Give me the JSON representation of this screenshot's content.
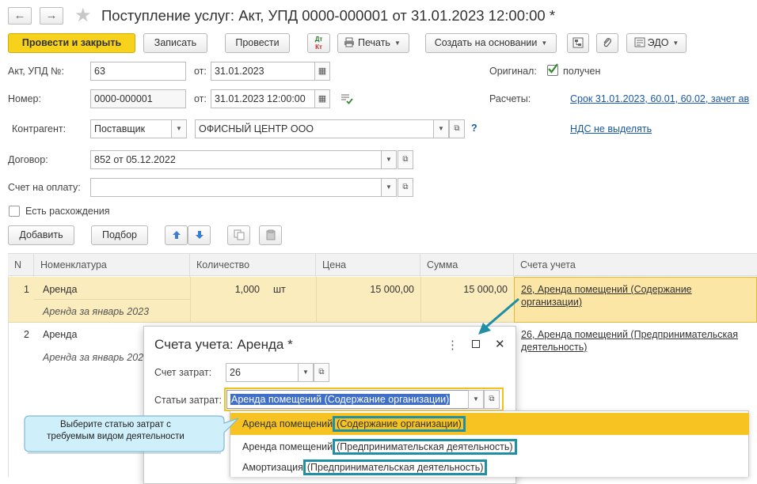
{
  "window": {
    "title": "Поступление услуг: Акт, УПД 0000-000001 от 31.01.2023 12:00:00 *",
    "back_glyph": "←",
    "forward_glyph": "→",
    "star_glyph": "★"
  },
  "toolbar": {
    "post_close": "Провести и закрыть",
    "save": "Записать",
    "post": "Провести",
    "dt_kt_top": "Дт",
    "dt_kt_bottom": "Кт",
    "print": "Печать",
    "create_based": "Создать на основании",
    "edo": "ЭДО"
  },
  "header": {
    "act_label": "Акт, УПД №:",
    "act_value": "63",
    "from_label": "от:",
    "act_date": "31.01.2023",
    "original_label": "Оригинал:",
    "original_checked": true,
    "original_value": "получен",
    "number_label": "Номер:",
    "number_value": "0000-000001",
    "from_label2": "от:",
    "number_date": "31.01.2023 12:00:00",
    "settlements_label": "Расчеты:",
    "settlements_link": "Срок 31.01.2023, 60.01, 60.02, зачет ав",
    "counterparty_label": "Контрагент:",
    "counterparty_type": "Поставщик",
    "counterparty_value": "ОФИСНЫЙ ЦЕНТР ООО",
    "help_glyph": "?",
    "vat_link": "НДС не выделять",
    "contract_label": "Договор:",
    "contract_value": "852 от 05.12.2022",
    "invoice_label": "Счет на оплату:",
    "invoice_value": "",
    "discrepancy_label": "Есть расхождения",
    "discrepancy_checked": false
  },
  "table_toolbar": {
    "add": "Добавить",
    "pick": "Подбор"
  },
  "table": {
    "columns": [
      "N",
      "Номенклатура",
      "Количество",
      "Цена",
      "Сумма",
      "Счета учета"
    ],
    "rows": [
      {
        "n": "1",
        "item": "Аренда",
        "item_note": "Аренда за январь 2023",
        "qty": "1,000",
        "unit": "шт",
        "price": "15 000,00",
        "sum": "15 000,00",
        "accounts_line1": "26, Аренда помещений (Содержание",
        "accounts_line2": "организации)"
      },
      {
        "n": "2",
        "item": "Аренда",
        "item_note": "Аренда за январь 2023",
        "accounts_line1": "26, Аренда помещений (Предпринимательская",
        "accounts_line2": "деятельность)"
      }
    ]
  },
  "dialog": {
    "title": "Счета учета: Аренда *",
    "more_glyph": "⋮",
    "close_glyph": "✕",
    "cost_account_label": "Счет затрат:",
    "cost_account_value": "26",
    "cost_items_label": "Статьи затрат:",
    "cost_items_value": "Аренда помещений (Содержание организации)"
  },
  "dropdown": {
    "items": [
      {
        "name": "Аренда помещений",
        "activity": "(Содержание организации)"
      },
      {
        "name": "Аренда помещений",
        "activity": "(Предпринимательская деятельность)"
      },
      {
        "name": "Амортизация",
        "activity": "(Предпринимательская деятельность)"
      }
    ]
  },
  "tooltip": {
    "line1": "Выберите статью затрат с",
    "line2": "требуемым видом деятельности"
  },
  "colors": {
    "accent_yellow": "#f6d21d",
    "highlight_teal": "#1e8fa5",
    "link_blue": "#1a58a8",
    "selected_row": "#fbecbd"
  }
}
